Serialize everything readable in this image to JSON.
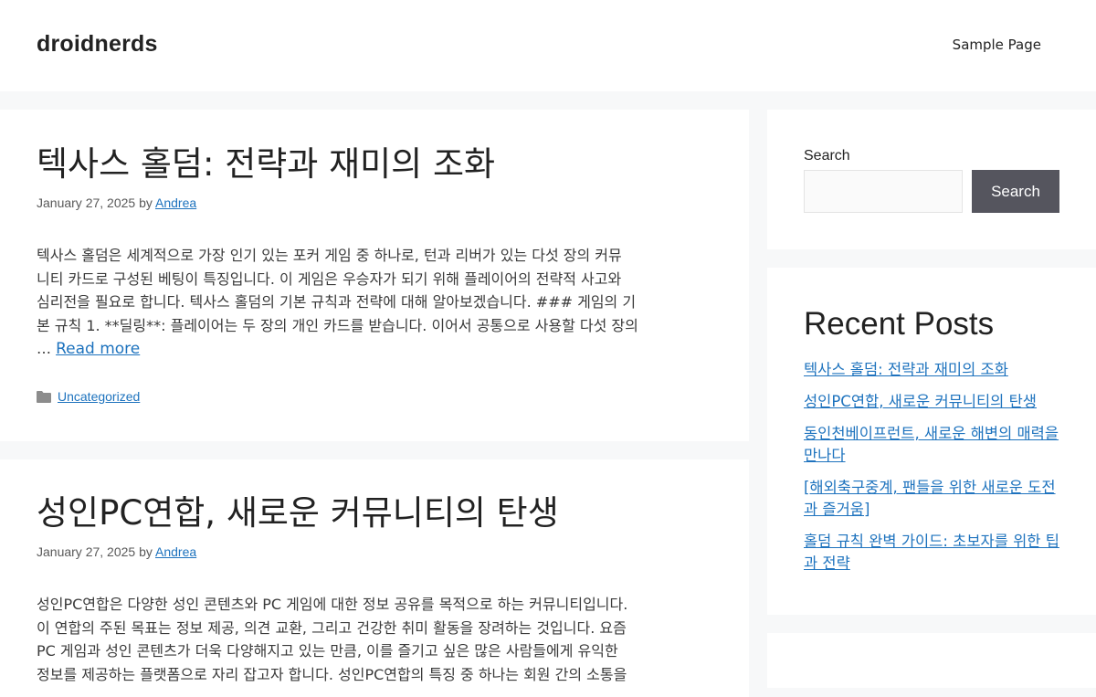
{
  "header": {
    "site_title": "droidnerds",
    "nav": {
      "sample_page": "Sample Page"
    }
  },
  "posts": [
    {
      "title": "텍사스 홀덤: 전략과 재미의 조화",
      "date": "January 27, 2025",
      "by": "by",
      "author": "Andrea",
      "summary_lines": [
        "텍사스 홀덤은 세계적으로 가장 인기 있는 포커 게임 중 하나로, 턴과 리버가 있는 다섯 장의 커뮤",
        "니티 카드로 구성된 베팅이 특징입니다. 이 게임은 우승자가 되기 위해 플레이어의 전략적 사고와",
        "심리전을 필요로 합니다. 텍사스 홀덤의 기본 규칙과 전략에 대해 알아보겠습니다. ### 게임의 기",
        "본 규칙 1. **딜링**: 플레이어는 두 장의 개인 카드를 받습니다. 이어서 공통으로 사용할 다섯 장의"
      ],
      "ellipsis": "… ",
      "read_more": "Read more",
      "category": "Uncategorized"
    },
    {
      "title": "성인PC연합, 새로운 커뮤니티의 탄생",
      "date": "January 27, 2025",
      "by": "by",
      "author": "Andrea",
      "summary_lines": [
        "성인PC연합은 다양한 성인 콘텐츠와 PC 게임에 대한 정보 공유를 목적으로 하는 커뮤니티입니다.",
        "이 연합의 주된 목표는 정보 제공, 의견 교환, 그리고 건강한 취미 활동을 장려하는 것입니다. 요즘",
        "PC 게임과 성인 콘텐츠가 더욱 다양해지고 있는 만큼, 이를 즐기고 싶은 많은 사람들에게 유익한",
        "정보를 제공하는 플랫폼으로 자리 잡고자 합니다. 성인PC연합의 특징 중 하나는 회원 간의 소통을"
      ]
    }
  ],
  "sidebar": {
    "search": {
      "label": "Search",
      "placeholder": "",
      "button_label": "Search"
    },
    "recent": {
      "title": "Recent Posts",
      "items": [
        "텍사스 홀덤: 전략과 재미의 조화",
        "성인PC연합, 새로운 커뮤니티의 탄생",
        "동인천베이프런트, 새로운 해변의 매력을 만나다",
        "[해외축구중계, 팬들을 위한 새로운 도전과 즐거움]",
        "홀덤 규칙 완벽 가이드: 초보자를 위한 팁과 전략"
      ]
    }
  },
  "colors": {
    "link": "#1e73be",
    "search_button_bg": "#55555e",
    "page_bg": "#f7f8f9"
  },
  "icons": {
    "category": "folder-icon"
  }
}
